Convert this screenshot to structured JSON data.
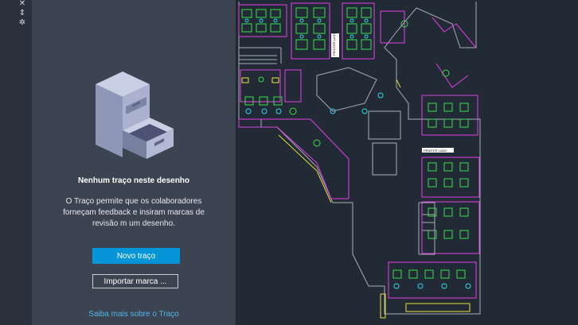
{
  "panel": {
    "empty_title": "Nenhum traço neste desenho",
    "empty_desc": "O Traço permite que os colaboradores forneçam feedback e insiram marcas de revisão m um desenho.",
    "new_trace_label": "Novo traço",
    "import_label": "Importar marca ...",
    "learn_more_label": "Saiba mais sobre o Traço"
  },
  "toolstrip": {
    "icons": [
      "close-icon",
      "pin-icon",
      "settings-icon"
    ]
  },
  "drawing": {
    "labels": [
      "PRINTER LAND",
      "PRINTER LAND"
    ]
  },
  "colors": {
    "accent": "#0696d7",
    "link": "#4fb6ea",
    "panel_bg": "#3c4452",
    "canvas_bg": "#222a36",
    "magenta": "#e33ee6",
    "green": "#37e04a",
    "cyan": "#2fd8e8",
    "yellow": "#e8e33a",
    "grey": "#a8adb5"
  }
}
